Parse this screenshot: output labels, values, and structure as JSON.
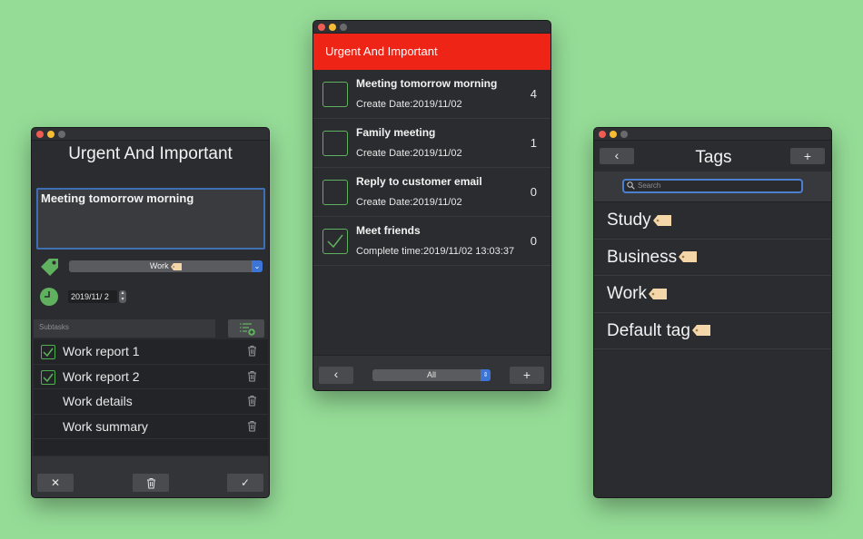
{
  "left_window": {
    "title": "Urgent And Important",
    "task_text": "Meeting tomorrow morning",
    "tag_value": "Work",
    "date_value": "2019/11/  2",
    "subtasks_label": "Subtasks",
    "subtasks": [
      {
        "label": "Work report 1",
        "checked": true
      },
      {
        "label": "Work report 2",
        "checked": true
      },
      {
        "label": "Work details",
        "checked": false
      },
      {
        "label": "Work summary",
        "checked": false
      }
    ],
    "cancel_label": "✕",
    "confirm_label": "✓"
  },
  "center_window": {
    "header": "Urgent And Important",
    "tasks": [
      {
        "title": "Meeting tomorrow morning",
        "sub": "Create Date:2019/11/02",
        "count": "4",
        "done": false
      },
      {
        "title": "Family meeting",
        "sub": "Create Date:2019/11/02",
        "count": "1",
        "done": false
      },
      {
        "title": "Reply to customer email",
        "sub": "Create Date:2019/11/02",
        "count": "0",
        "done": false
      },
      {
        "title": "Meet friends",
        "sub": "Complete time:2019/11/02 13:03:37",
        "count": "0",
        "done": true
      }
    ],
    "back_label": "‹",
    "filter_value": "All",
    "add_label": "+"
  },
  "right_window": {
    "title": "Tags",
    "back_label": "‹",
    "add_label": "+",
    "search_placeholder": "Search",
    "tags": [
      "Study",
      "Business",
      "Work",
      "Default tag"
    ]
  },
  "colors": {
    "background": "#95dd97",
    "header_red": "#ee2416",
    "check_green": "#5fb15f",
    "accent_blue": "#3c74d8"
  }
}
